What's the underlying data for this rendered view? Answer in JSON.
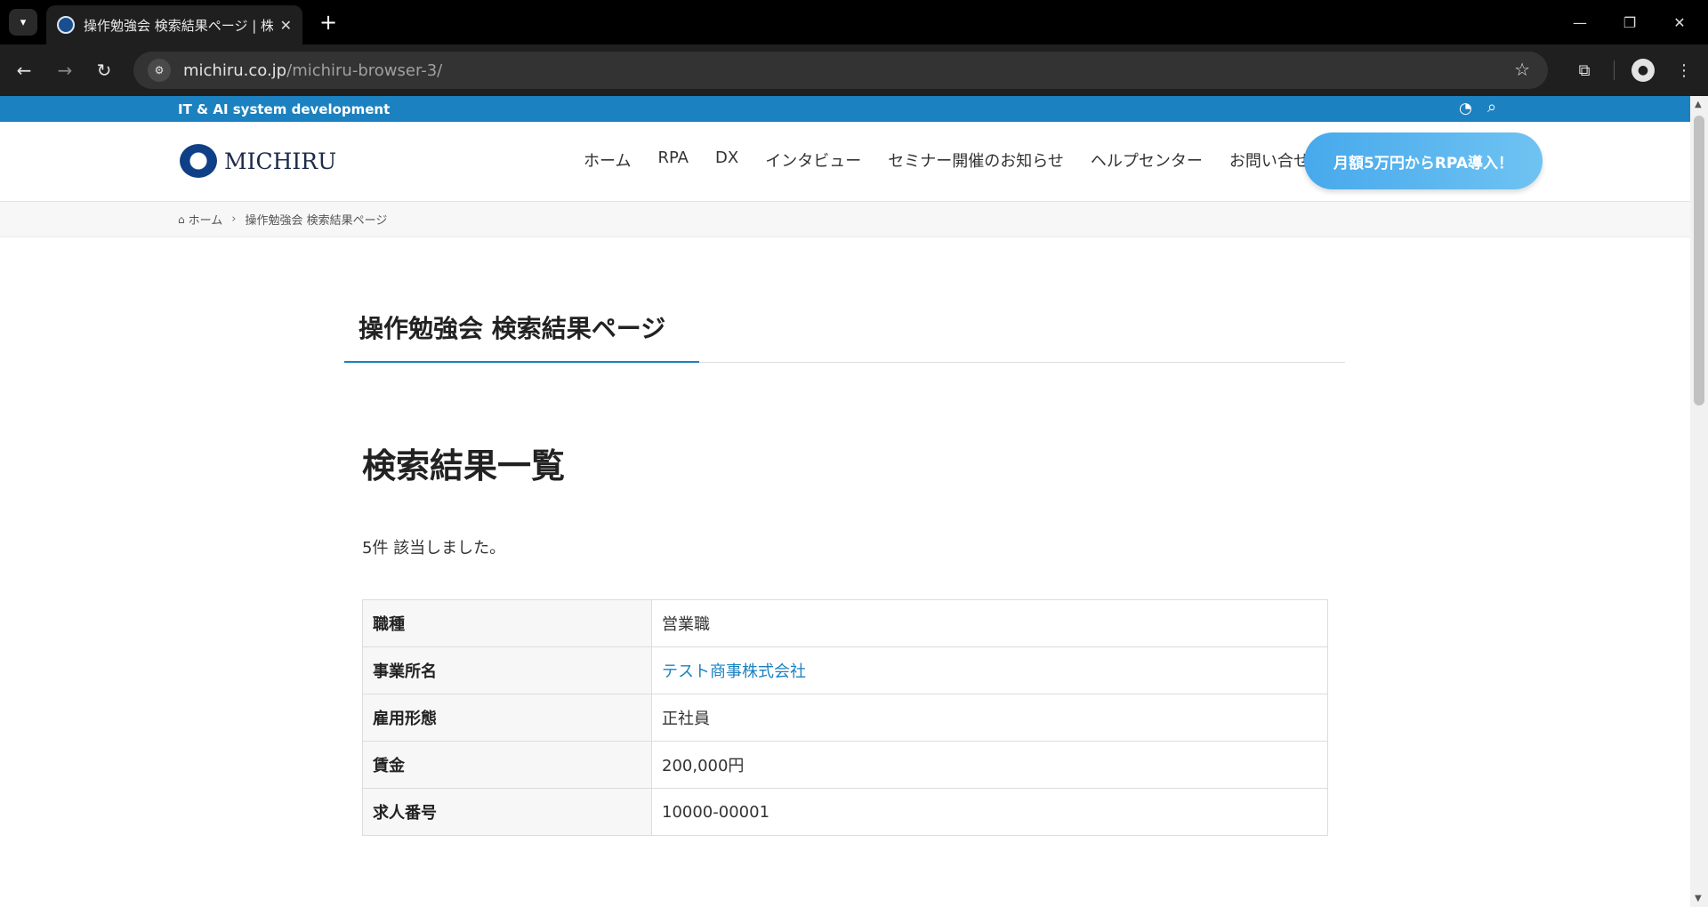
{
  "browser": {
    "tab_title": "操作勉強会 検索結果ページ | 株式",
    "tab_close": "✕",
    "new_tab": "+",
    "url_domain": "michiru.co.jp",
    "url_path": "/michiru-browser-3/",
    "window_controls": [
      "—",
      "❐",
      "✕"
    ]
  },
  "site": {
    "tagline": "IT & AI system development",
    "logo_text": "MICHIRU",
    "nav": [
      "ホーム",
      "RPA",
      "DX",
      "インタビュー",
      "セミナー開催のお知らせ",
      "ヘルプセンター",
      "お問い合せ"
    ],
    "cta": "月額5万円からRPA導入！"
  },
  "breadcrumb": {
    "home": "ホーム",
    "current": "操作勉強会 検索結果ページ"
  },
  "page": {
    "title": "操作勉強会 検索結果ページ",
    "heading": "検索結果一覧",
    "count_text": "5件 該当しました。"
  },
  "results": {
    "rows": [
      {
        "key": "職種",
        "value": "営業職",
        "link": false
      },
      {
        "key": "事業所名",
        "value": "テスト商事株式会社",
        "link": true
      },
      {
        "key": "雇用形態",
        "value": "正社員",
        "link": false
      },
      {
        "key": "賃金",
        "value": "200,000円",
        "link": false
      },
      {
        "key": "求人番号",
        "value": "10000-00001",
        "link": false
      }
    ]
  },
  "colors": {
    "brand_blue": "#1c81c0",
    "cta_gradient_start": "#47a9ec",
    "cta_gradient_end": "#6fc3f2"
  }
}
